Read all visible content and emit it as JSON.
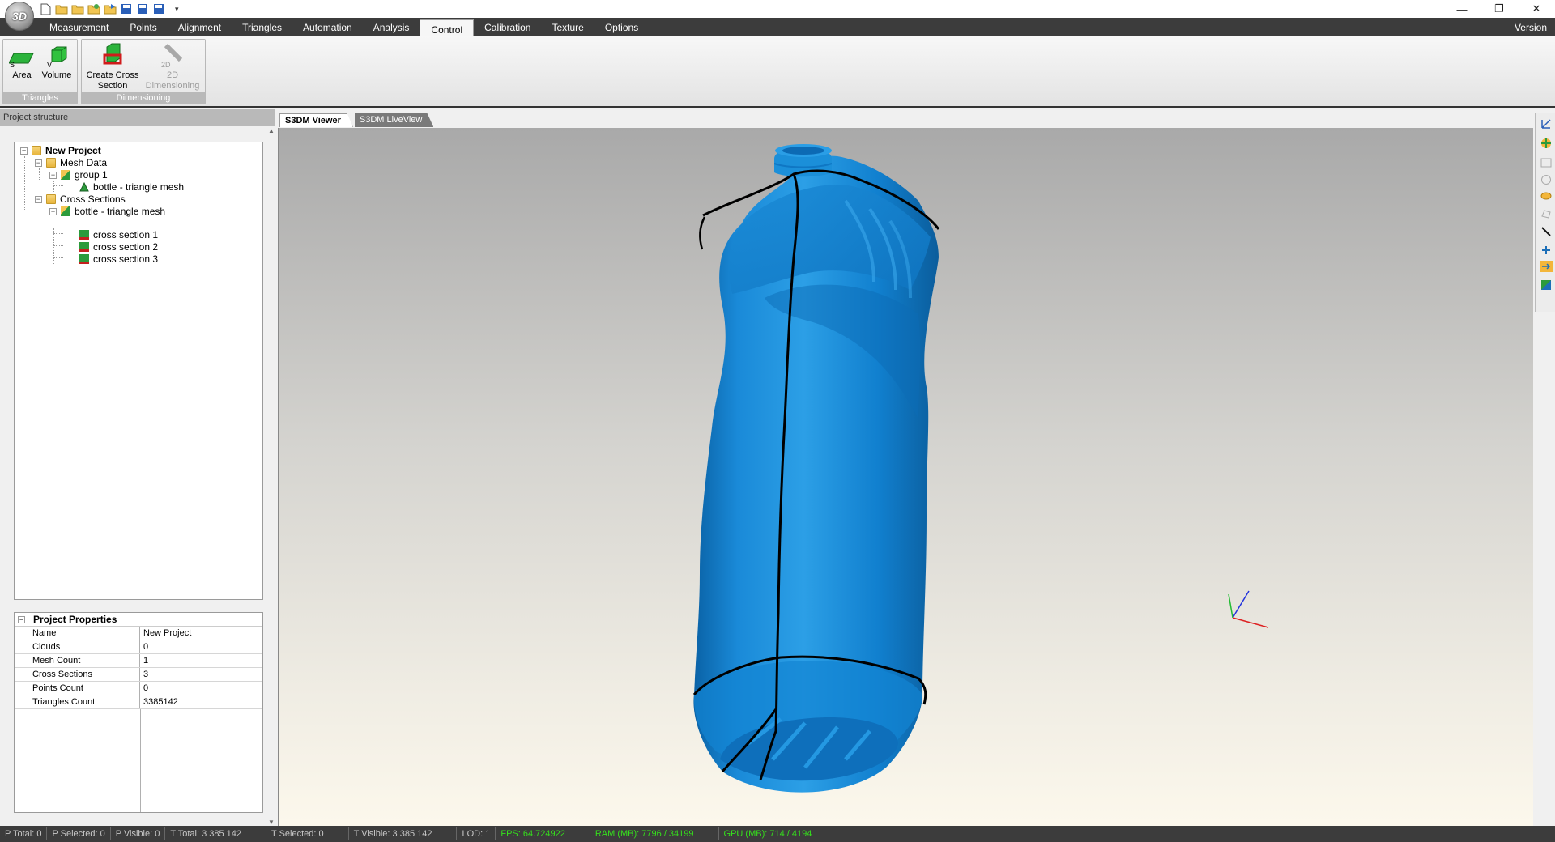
{
  "app": {
    "logo_text": "3D",
    "quick_access": [
      "new-file-icon",
      "open-folder-icon",
      "open-folder-icon",
      "import-icon",
      "export-icon",
      "save-icon",
      "save-as-icon",
      "save-all-icon"
    ],
    "window_controls": [
      "minimize-icon",
      "restore-icon",
      "close-icon"
    ]
  },
  "menu": {
    "tabs": [
      "Measurement",
      "Points",
      "Alignment",
      "Triangles",
      "Automation",
      "Analysis",
      "Control",
      "Calibration",
      "Texture",
      "Options"
    ],
    "active_tab": "Control",
    "version_label": "Version"
  },
  "ribbon": {
    "groups": [
      {
        "label": "Triangles",
        "buttons": [
          {
            "label": "Area",
            "icon": "area-icon",
            "icon_letter": "S"
          },
          {
            "label": "Volume",
            "icon": "volume-icon",
            "icon_letter": "V"
          }
        ]
      },
      {
        "label": "Dimensioning",
        "buttons": [
          {
            "label": "Create Cross Section",
            "icon": "cross-section-icon"
          },
          {
            "label": "2D Dimensioning",
            "icon": "dimensioning-icon",
            "icon_letter": "2D",
            "disabled": true
          }
        ]
      }
    ]
  },
  "left_panel": {
    "header": "Project structure",
    "tree": [
      {
        "label": "New Project",
        "level": 0,
        "icon": "folder-icon",
        "expander": "minus",
        "bold": true
      },
      {
        "label": "Mesh Data",
        "level": 1,
        "icon": "folder-icon",
        "expander": "minus"
      },
      {
        "label": "group 1",
        "level": 2,
        "icon": "group-icon",
        "expander": "minus"
      },
      {
        "label": "bottle - triangle mesh",
        "level": 3,
        "icon": "triangle-mesh-icon"
      },
      {
        "label": "Cross Sections",
        "level": 1,
        "icon": "folder-icon",
        "expander": "minus"
      },
      {
        "label": "bottle - triangle mesh",
        "level": 2,
        "icon": "cross-section-group-icon",
        "expander": "minus"
      },
      {
        "label": "cross section 1",
        "level": 3,
        "icon": "cross-section-icon"
      },
      {
        "label": "cross section 2",
        "level": 3,
        "icon": "cross-section-icon"
      },
      {
        "label": "cross section 3",
        "level": 3,
        "icon": "cross-section-icon"
      }
    ],
    "properties": {
      "header": "Project Properties",
      "rows": [
        {
          "key": "Name",
          "value": "New Project"
        },
        {
          "key": "Clouds",
          "value": "0"
        },
        {
          "key": "Mesh Count",
          "value": "1"
        },
        {
          "key": "Cross Sections",
          "value": "3"
        },
        {
          "key": "Points Count",
          "value": "0"
        },
        {
          "key": "Triangles Count",
          "value": "3385142"
        }
      ]
    }
  },
  "viewer": {
    "tabs": [
      "S3DM Viewer",
      "S3DM LiveView"
    ],
    "active_tab": "S3DM Viewer",
    "model_color": "#1289d6",
    "background_top": "#a9a9a9",
    "background_bottom": "#fcf8ec"
  },
  "right_toolbar": [
    "axis-view-icon",
    "rotate-icon",
    "rectangle-select-icon",
    "circle-select-icon",
    "lasso-select-icon",
    "polygon-select-icon",
    "line-tool-icon",
    "point-pick-icon",
    "arrow-tool-icon",
    "color-map-icon"
  ],
  "status": {
    "items": [
      {
        "text": "P Total: 0",
        "color": "gray"
      },
      {
        "text": "P Selected: 0",
        "color": "gray"
      },
      {
        "text": "P Visible: 0",
        "color": "gray"
      },
      {
        "text": "T Total: 3 385 142",
        "color": "gray"
      },
      {
        "text": "T Selected: 0",
        "color": "gray"
      },
      {
        "text": "T Visible: 3 385 142",
        "color": "gray"
      },
      {
        "text": "LOD: 1",
        "color": "gray"
      },
      {
        "text": "FPS: 64.724922",
        "color": "green"
      },
      {
        "text": "RAM (MB): 7796 / 34199",
        "color": "green"
      },
      {
        "text": "GPU (MB): 714 / 4194",
        "color": "green"
      }
    ]
  }
}
